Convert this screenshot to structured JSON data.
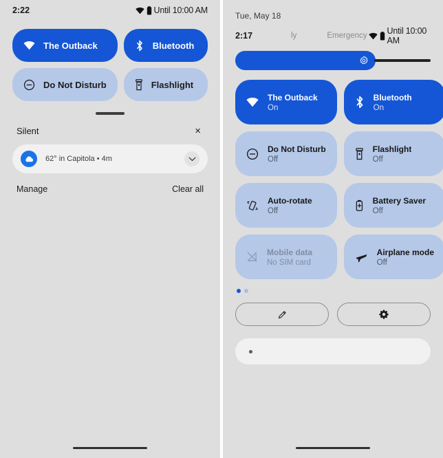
{
  "left_panel": {
    "status_bar": {
      "clock": "2:22",
      "wifi_icon": "wifi-icon",
      "battery_icon": "battery-icon",
      "dnd_until": "Until 10:00 AM"
    },
    "tiles": [
      {
        "label": "The Outback",
        "icon": "wifi-icon",
        "state": "on"
      },
      {
        "label": "Bluetooth",
        "icon": "bluetooth-icon",
        "state": "on"
      },
      {
        "label": "Do Not Disturb",
        "icon": "do-not-disturb-icon",
        "state": "off"
      },
      {
        "label": "Flashlight",
        "icon": "flashlight-icon",
        "state": "off"
      }
    ],
    "drag_handle": "drag-handle",
    "notifications": {
      "section_title": "Silent",
      "close_icon": "×",
      "items": [
        {
          "app_icon": "weather-cloud-icon",
          "text": "62° in Capitola • 4m",
          "expand_icon": "chevron-down-icon"
        }
      ],
      "manage_label": "Manage",
      "clear_all_label": "Clear all"
    }
  },
  "right_panel": {
    "date": "Tue, May 18",
    "status_bar": {
      "clock": "2:17",
      "carrier": "ly",
      "emergency": "Emergency",
      "wifi_icon": "wifi-icon",
      "battery_icon": "battery-icon",
      "dnd_until": "Until 10:00 AM"
    },
    "brightness": {
      "icon": "brightness-icon",
      "percent": 72
    },
    "tiles": [
      {
        "title": "The Outback",
        "subtitle": "On",
        "icon": "wifi-icon",
        "state": "on"
      },
      {
        "title": "Bluetooth",
        "subtitle": "On",
        "icon": "bluetooth-icon",
        "state": "on"
      },
      {
        "title": "Do Not Disturb",
        "subtitle": "Off",
        "icon": "do-not-disturb-icon",
        "state": "off"
      },
      {
        "title": "Flashlight",
        "subtitle": "Off",
        "icon": "flashlight-icon",
        "state": "off"
      },
      {
        "title": "Auto-rotate",
        "subtitle": "Off",
        "icon": "auto-rotate-icon",
        "state": "off"
      },
      {
        "title": "Battery Saver",
        "subtitle": "Off",
        "icon": "battery-saver-icon",
        "state": "off"
      },
      {
        "title": "Mobile data",
        "subtitle": "No SIM card",
        "icon": "mobile-data-off-icon",
        "state": "disabled"
      },
      {
        "title": "Airplane mode",
        "subtitle": "Off",
        "icon": "airplane-icon",
        "state": "off"
      }
    ],
    "page_indicator": {
      "total": 2,
      "active": 1
    },
    "footer_buttons": [
      {
        "icon": "pencil-icon",
        "name": "edit-tiles-button"
      },
      {
        "icon": "gear-icon",
        "name": "settings-button"
      }
    ],
    "shade_pill": {
      "icon": "collapsed-notification-dot"
    }
  },
  "colors": {
    "background": "#dedede",
    "tile_on": "#1456d6",
    "tile_off": "#b5c8e8",
    "card": "#f1f1f1",
    "accent": "#1456d6"
  }
}
